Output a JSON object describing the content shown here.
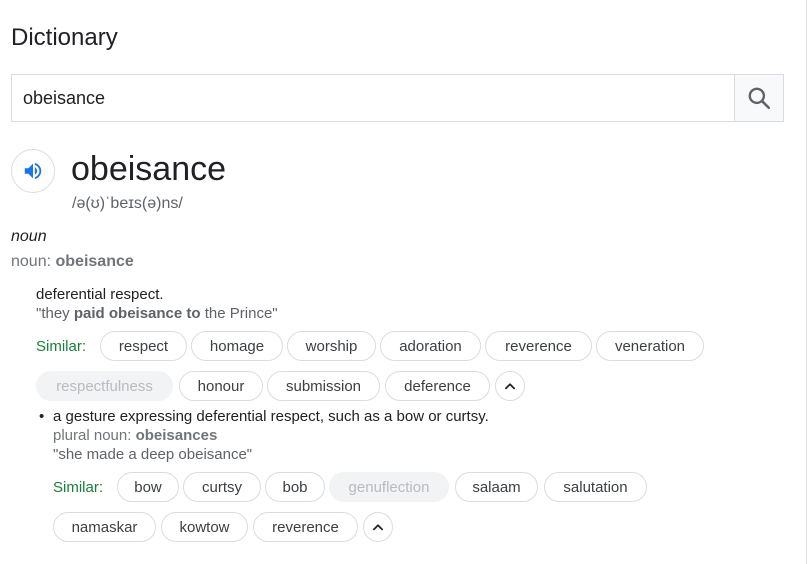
{
  "title": "Dictionary",
  "search": {
    "value": "obeisance",
    "button_icon": "search-icon"
  },
  "entry": {
    "word": "obeisance",
    "phonetic": "/ə(ʊ)ˈbeɪs(ə)ns/",
    "speaker_icon": "speaker-icon",
    "part_of_speech": "noun",
    "noun_prefix": "noun:",
    "noun_word": "obeisance"
  },
  "sense1": {
    "definition": "deferential respect.",
    "example": {
      "q1": "\"they ",
      "b1": "paid",
      "t1": " ",
      "b2": "obeisance to",
      "t2": " the Prince\""
    },
    "similar_label": "Similar:",
    "chips_row1": [
      "respect",
      "homage",
      "worship",
      "adoration",
      "reverence",
      "veneration"
    ],
    "chips_row2": [
      "respectfulness",
      "honour",
      "submission",
      "deference"
    ],
    "disabled_chip": "respectfulness"
  },
  "sense2": {
    "bullet": "•",
    "definition": "a gesture expressing deferential respect, such as a bow or curtsy.",
    "plural_prefix": "plural noun:",
    "plural_word": "obeisances",
    "example": "\"she made a deep obeisance\"",
    "similar_label": "Similar:",
    "chips_row1": [
      "bow",
      "curtsy",
      "bob",
      "genuflection",
      "salaam",
      "salutation"
    ],
    "chips_row2": [
      "namaskar",
      "kowtow",
      "reverence"
    ],
    "disabled_chip": "genuflection"
  },
  "colors": {
    "similar_green": "#188038",
    "accent_blue": "#1a73e8"
  }
}
